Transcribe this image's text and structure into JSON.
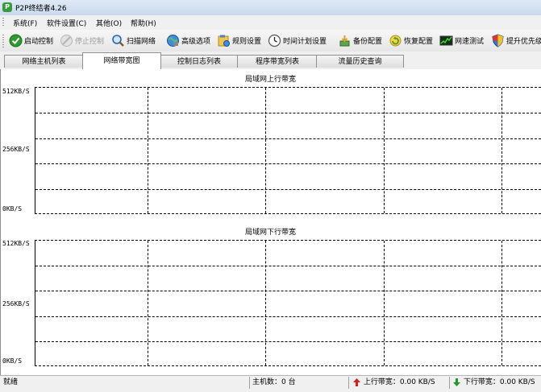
{
  "window": {
    "title": "P2P终结者4.26",
    "icon": "app-icon"
  },
  "menu": [
    "系统(F)",
    "软件设置(C)",
    "其他(O)",
    "帮助(H)"
  ],
  "toolbar": [
    {
      "label": "启动控制",
      "icon": "start-control-icon",
      "enabled": true
    },
    {
      "label": "停止控制",
      "icon": "stop-control-icon",
      "enabled": false
    },
    {
      "label": "扫描网络",
      "icon": "scan-network-icon",
      "enabled": true
    },
    {
      "label": "高级选项",
      "icon": "advanced-options-icon",
      "enabled": true
    },
    {
      "label": "规则设置",
      "icon": "rule-settings-icon",
      "enabled": true
    },
    {
      "label": "时间计划设置",
      "icon": "schedule-clock-icon",
      "enabled": true
    },
    {
      "label": "备份配置",
      "icon": "backup-config-icon",
      "enabled": true
    },
    {
      "label": "恢复配置",
      "icon": "restore-config-icon",
      "enabled": true
    },
    {
      "label": "网速测试",
      "icon": "speed-test-icon",
      "enabled": true
    },
    {
      "label": "提升优先级",
      "icon": "priority-shield-icon",
      "enabled": true
    }
  ],
  "tabs": [
    {
      "label": "网络主机列表",
      "active": false
    },
    {
      "label": "网络带宽图",
      "active": true
    },
    {
      "label": "控制日志列表",
      "active": false
    },
    {
      "label": "程序带宽列表",
      "active": false
    },
    {
      "label": "流量历史查询",
      "active": false
    }
  ],
  "charts": {
    "upload": {
      "title": "局域网上行带宽",
      "ticks": [
        "512KB/S",
        "256KB/S",
        "0KB/S"
      ]
    },
    "download": {
      "title": "局域网下行带宽",
      "ticks": [
        "512KB/S",
        "256KB/S",
        "0KB/S"
      ]
    }
  },
  "chart_data": [
    {
      "type": "line",
      "title": "局域网上行带宽",
      "xlabel": "",
      "ylabel": "",
      "ylim": [
        0,
        512
      ],
      "yticks": [
        "512KB/S",
        "256KB/S",
        "0KB/S"
      ],
      "grid": true,
      "series": []
    },
    {
      "type": "line",
      "title": "局域网下行带宽",
      "xlabel": "",
      "ylabel": "",
      "ylim": [
        0,
        512
      ],
      "yticks": [
        "512KB/S",
        "256KB/S",
        "0KB/S"
      ],
      "grid": true,
      "series": []
    }
  ],
  "statusbar": {
    "status": "就绪",
    "hosts": "主机数：0 台",
    "upload": "上行带宽：0.00 KB/S",
    "download": "下行带宽：0.00 KB/S"
  },
  "colors": {
    "up_arrow": "#d42020",
    "down_arrow": "#1e9a2a"
  }
}
